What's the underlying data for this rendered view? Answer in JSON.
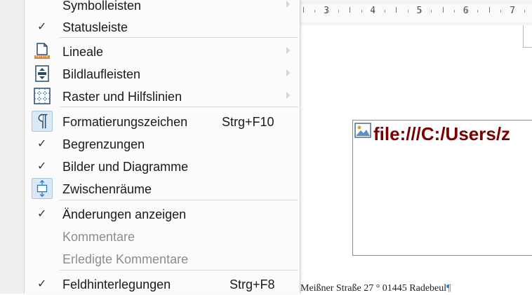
{
  "document": {
    "ruler_numbers": [
      "3",
      "4",
      "5",
      "6",
      "7"
    ],
    "image_link_text": "file:///C:/Users/z",
    "footer_text": "Meißner Straße 27 ° 01445 Radebeul",
    "pilcrow": "¶"
  },
  "menu": {
    "items": [
      {
        "label": "Symbolleisten",
        "checked": false,
        "submenu": true
      },
      {
        "label": "Statusleiste",
        "checked": true,
        "check_glyph": "✓"
      },
      {
        "label": "Lineale",
        "icon": "ruler-icon",
        "submenu": true
      },
      {
        "label": "Bildlaufleisten",
        "icon": "scrollbars-icon",
        "submenu": true
      },
      {
        "label": "Raster und Hilfslinien",
        "icon": "grid-icon",
        "submenu": true
      },
      {
        "label": "Formatierungszeichen",
        "icon": "pilcrow-icon",
        "shortcut": "Strg+F10",
        "active": true
      },
      {
        "label": "Begrenzungen",
        "checked": true,
        "check_glyph": "✓"
      },
      {
        "label": "Bilder und Diagramme",
        "checked": true,
        "check_glyph": "✓"
      },
      {
        "label": "Zwischenräume",
        "icon": "whitespace-icon",
        "active": true
      },
      {
        "label": "Änderungen anzeigen",
        "checked": true,
        "check_glyph": "✓"
      },
      {
        "label": "Kommentare",
        "disabled": true
      },
      {
        "label": "Erledigte Kommentare",
        "disabled": true
      },
      {
        "label": "Feldhinterlegungen",
        "checked": true,
        "check_glyph": "✓",
        "shortcut": "Strg+F8"
      }
    ]
  },
  "colors": {
    "link_text": "#7a0000",
    "active_icon_bg": "#dbe8f5",
    "icon_blue": "#1f7bd0",
    "icon_orange": "#e08a2c"
  }
}
